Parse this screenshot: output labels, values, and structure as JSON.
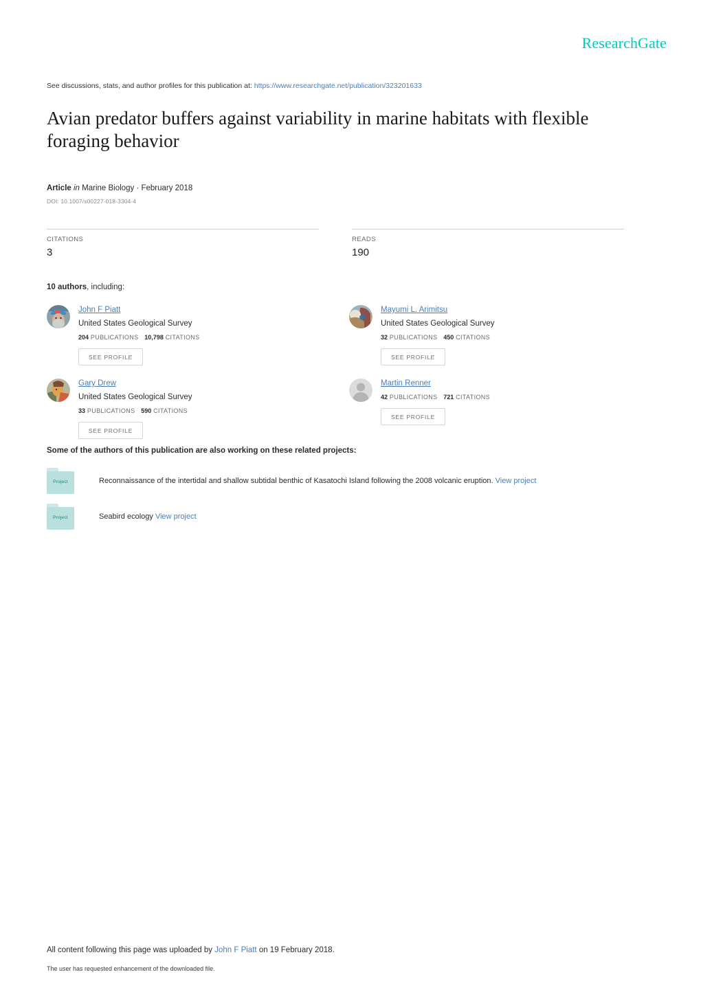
{
  "brand": {
    "name": "ResearchGate",
    "color": "#00ccbb"
  },
  "header": {
    "see_discussions_prefix": "See discussions, stats, and author profiles for this publication at:",
    "publication_url": "https://www.researchgate.net/publication/323201633"
  },
  "publication": {
    "title": "Avian predator buffers against variability in marine habitats with flexible foraging behavior",
    "type_label": "Article",
    "in_label": "in",
    "venue": "Marine Biology · February 2018",
    "doi": "DOI: 10.1007/s00227-018-3304-4"
  },
  "metrics": [
    {
      "label": "CITATIONS",
      "value": "3"
    },
    {
      "label": "READS",
      "value": "190"
    }
  ],
  "authors_section": {
    "count_label": "10 authors",
    "including_label": ", including:",
    "see_profile_label": "SEE PROFILE",
    "publications_label": "PUBLICATIONS",
    "citations_label": "CITATIONS",
    "authors": [
      {
        "name": "John F Piatt",
        "institution": "United States Geological Survey",
        "publications": "204",
        "citations": "10,798",
        "avatar": "photo"
      },
      {
        "name": "Mayumi L. Arimitsu",
        "institution": "United States Geological Survey",
        "publications": "32",
        "citations": "450",
        "avatar": "photo"
      },
      {
        "name": "Gary Drew",
        "institution": "United States Geological Survey",
        "publications": "33",
        "citations": "590",
        "avatar": "photo"
      },
      {
        "name": "Martin Renner",
        "institution": "",
        "publications": "42",
        "citations": "721",
        "avatar": "placeholder"
      }
    ]
  },
  "projects_section": {
    "heading": "Some of the authors of this publication are also working on these related projects:",
    "folder_label": "Project",
    "view_project_label": "View project",
    "projects": [
      {
        "title": "Reconnaissance of the intertidal and shallow subtidal benthic of Kasatochi Island following the 2008 volcanic eruption."
      },
      {
        "title": "Seabird ecology"
      }
    ]
  },
  "footer": {
    "upload_prefix": "All content following this page was uploaded by",
    "uploader": "John F Piatt",
    "upload_suffix": "on 19 February 2018.",
    "enhancement_note": "The user has requested enhancement of the downloaded file."
  }
}
